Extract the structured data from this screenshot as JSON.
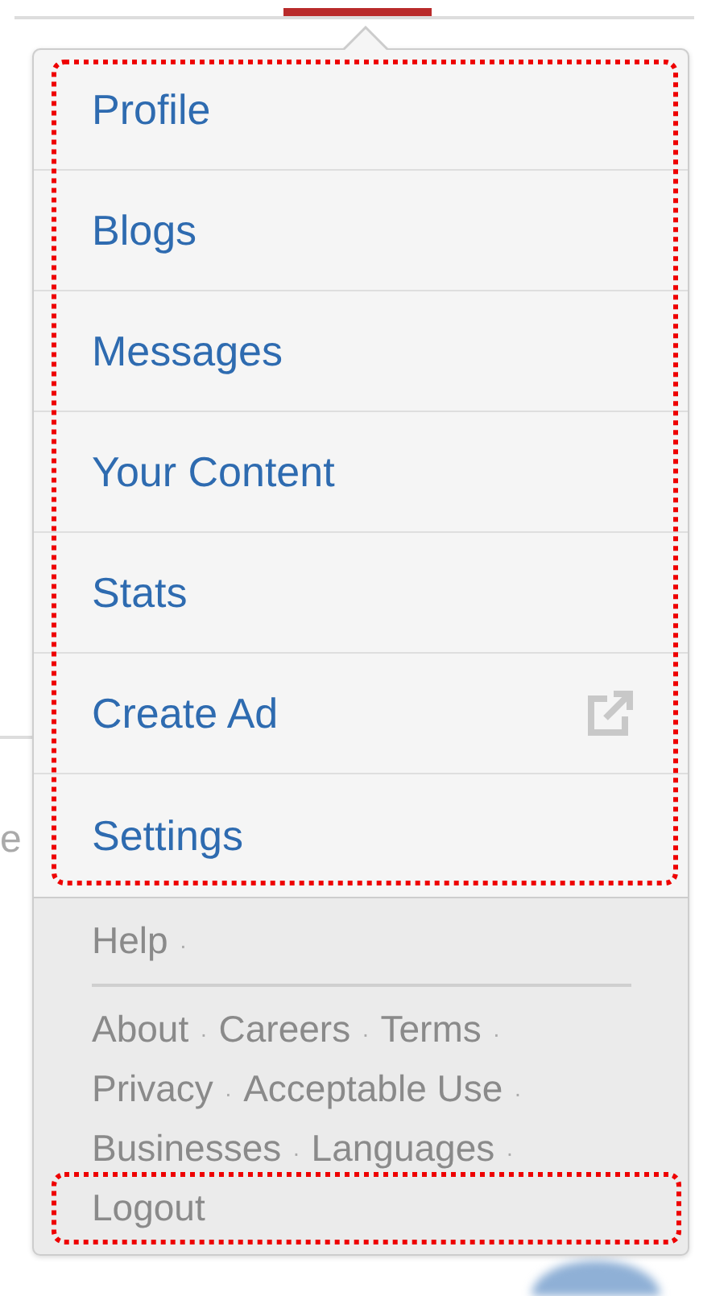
{
  "background_text": "e",
  "menu": {
    "highlighted": true,
    "items": [
      {
        "label": "Profile",
        "external": false
      },
      {
        "label": "Blogs",
        "external": false
      },
      {
        "label": "Messages",
        "external": false
      },
      {
        "label": "Your Content",
        "external": false
      },
      {
        "label": "Stats",
        "external": false
      },
      {
        "label": "Create Ad",
        "external": true
      },
      {
        "label": "Settings",
        "external": false
      }
    ]
  },
  "footer": {
    "separator": "·",
    "help": "Help",
    "rows": [
      [
        "About",
        "Careers",
        "Terms"
      ],
      [
        "Privacy",
        "Acceptable Use"
      ],
      [
        "Businesses",
        "Languages"
      ]
    ],
    "logout": {
      "label": "Logout",
      "highlighted": true
    }
  }
}
